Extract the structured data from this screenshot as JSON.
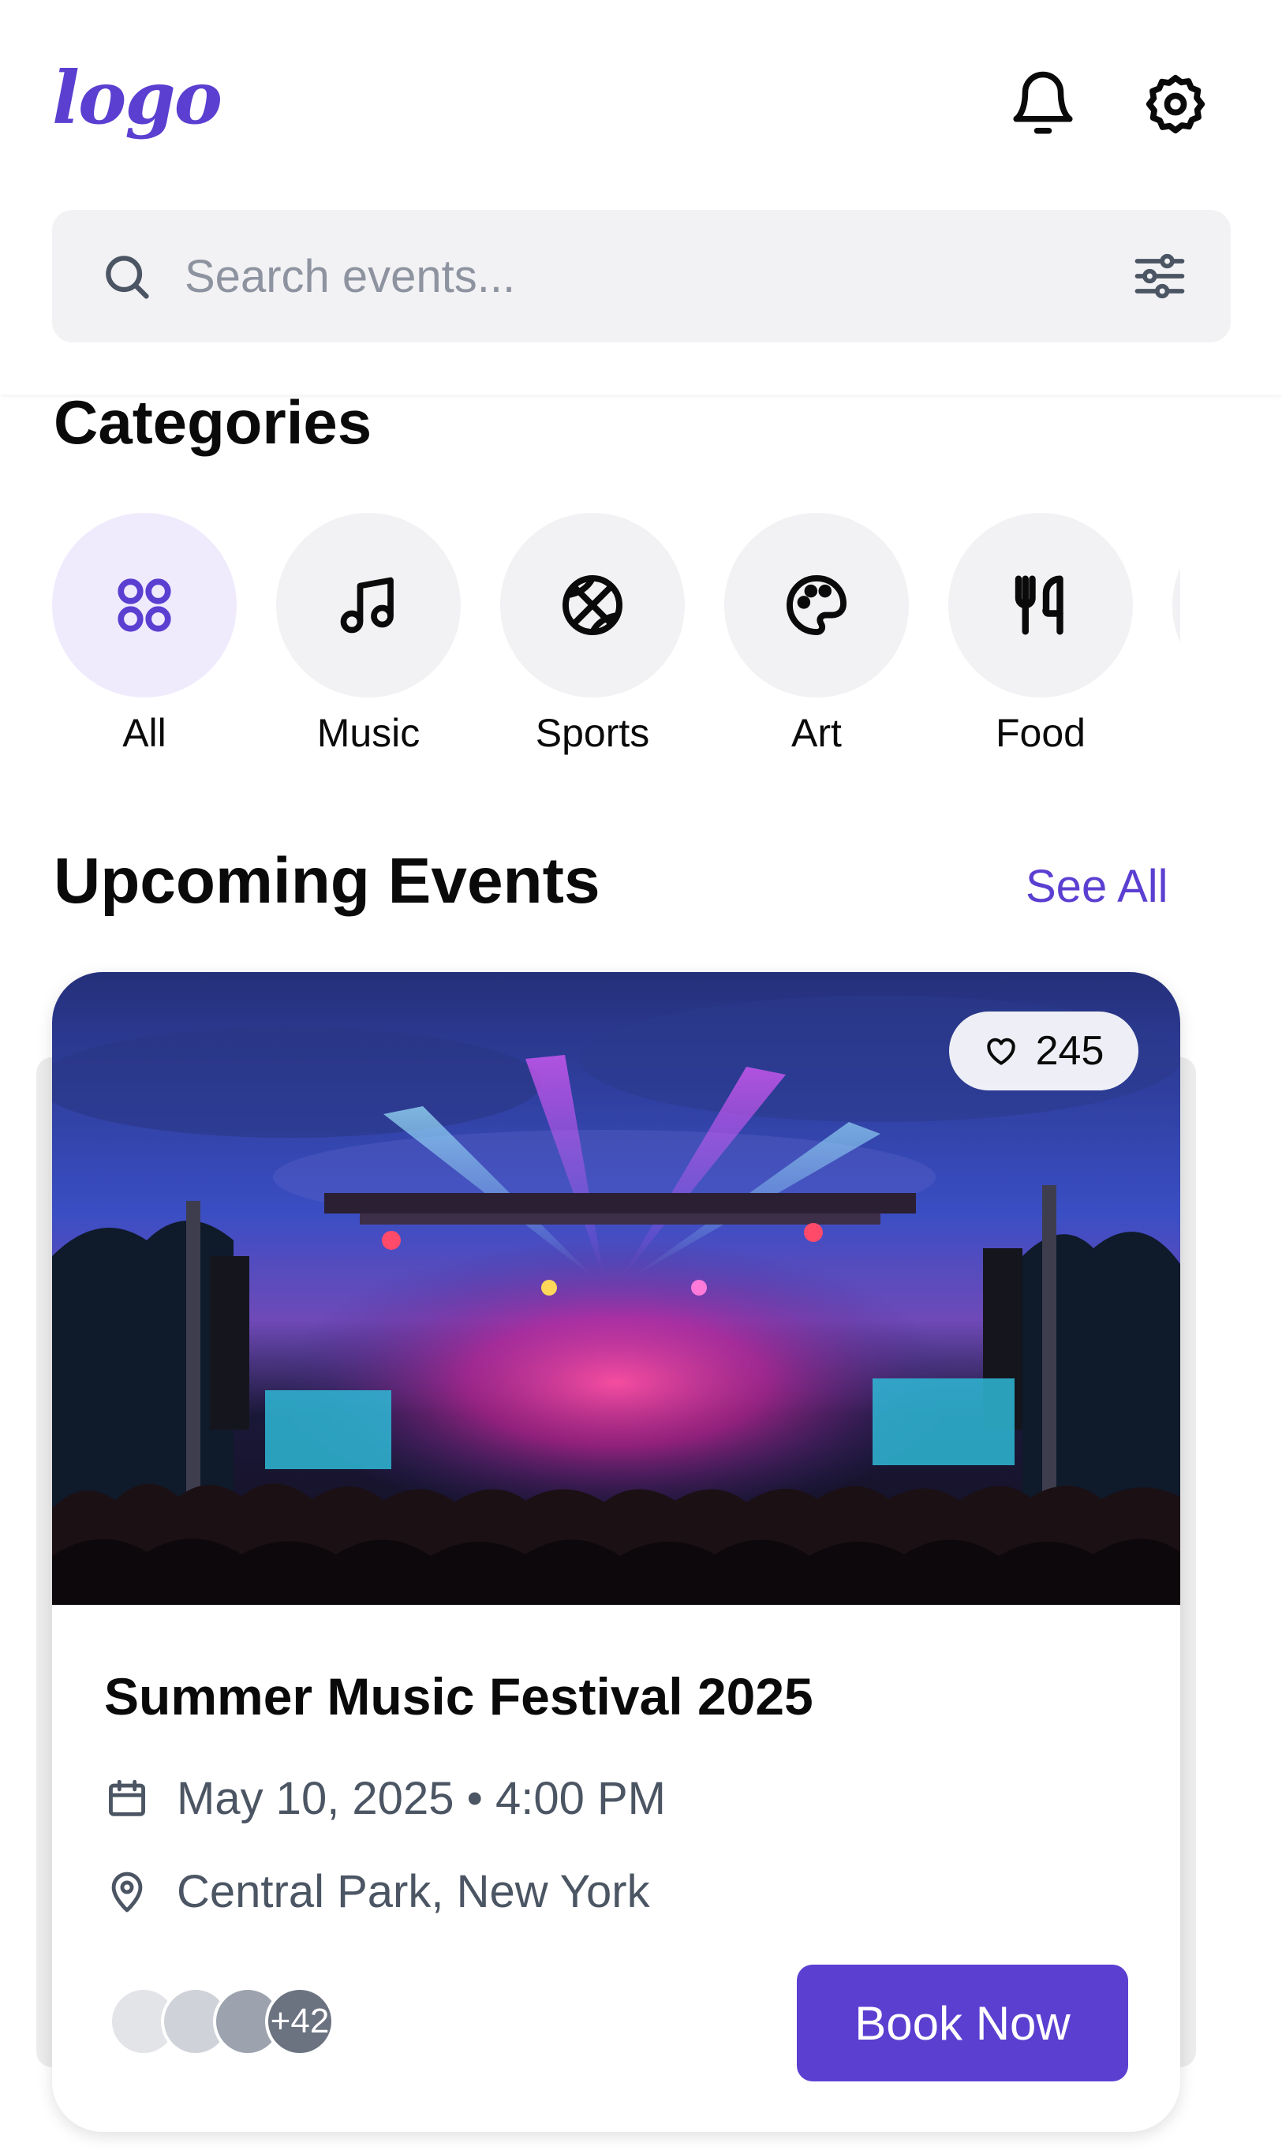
{
  "header": {
    "logo_text": "logo",
    "icons": [
      "bell-icon",
      "gear-icon"
    ]
  },
  "search": {
    "placeholder": "Search events...",
    "icons": [
      "search-icon",
      "filter-sliders-icon"
    ]
  },
  "categories": {
    "title": "Categories",
    "items": [
      {
        "label": "All",
        "icon": "grid-icon",
        "active": true
      },
      {
        "label": "Music",
        "icon": "music-note-icon",
        "active": false
      },
      {
        "label": "Sports",
        "icon": "basketball-icon",
        "active": false
      },
      {
        "label": "Art",
        "icon": "palette-icon",
        "active": false
      },
      {
        "label": "Food",
        "icon": "utensils-icon",
        "active": false
      }
    ]
  },
  "upcoming": {
    "title": "Upcoming Events",
    "see_all": "See All",
    "event": {
      "title": "Summer Music Festival 2025",
      "likes": "245",
      "date_time": "May 10, 2025 • 4:00 PM",
      "location": "Central Park, New York",
      "attendees_more": "+42",
      "book_label": "Book Now",
      "image_alt": "concert-stage-photo"
    }
  },
  "colors": {
    "accent": "#5b3fd1",
    "accent_soft": "#efebfd",
    "chip_bg": "#f2f2f4",
    "muted_text": "#4b5563"
  }
}
